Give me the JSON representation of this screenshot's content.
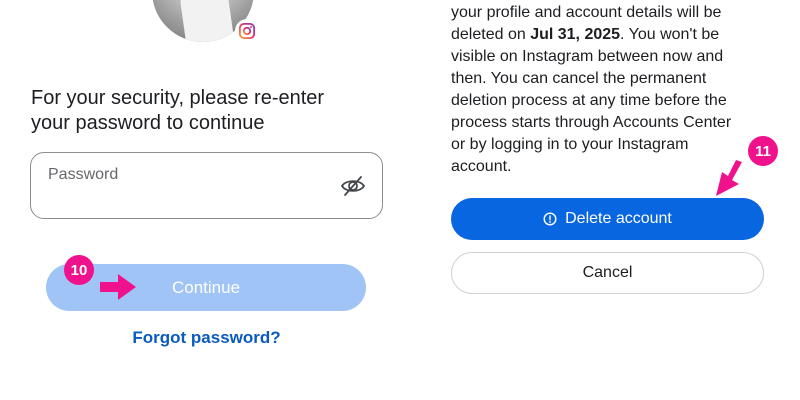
{
  "left_panel": {
    "heading_line1": "For your security, please re-enter",
    "heading_line2": "your password to continue",
    "password_placeholder": "Password",
    "continue_label": "Continue",
    "forgot_label": "Forgot password?"
  },
  "right_panel": {
    "desc_line1": "your profile and account details will be",
    "desc_line2_prefix": "deleted on ",
    "desc_date": "Jul 31, 2025",
    "desc_line2_suffix": ". You won't be",
    "desc_line3": "visible on Instagram between now and",
    "desc_line4": "then. You can cancel the permanent",
    "desc_line5": "deletion process at any time before the",
    "desc_line6": "process starts through Accounts Center",
    "desc_line7": "or by logging in to your Instagram",
    "desc_line8": "account.",
    "delete_label": "Delete account",
    "cancel_label": "Cancel"
  },
  "annotations": {
    "step_a": "10",
    "step_b": "11",
    "badge_color": "#f0128d"
  },
  "colors": {
    "primary_blue": "#0866e0",
    "disabled_blue": "#a0c4f6",
    "link_blue": "#0a5bbf"
  },
  "icons": {
    "avatar_badge": "instagram-icon",
    "password_toggle": "eye-slash-icon",
    "delete_prefix": "info-circle-icon"
  }
}
